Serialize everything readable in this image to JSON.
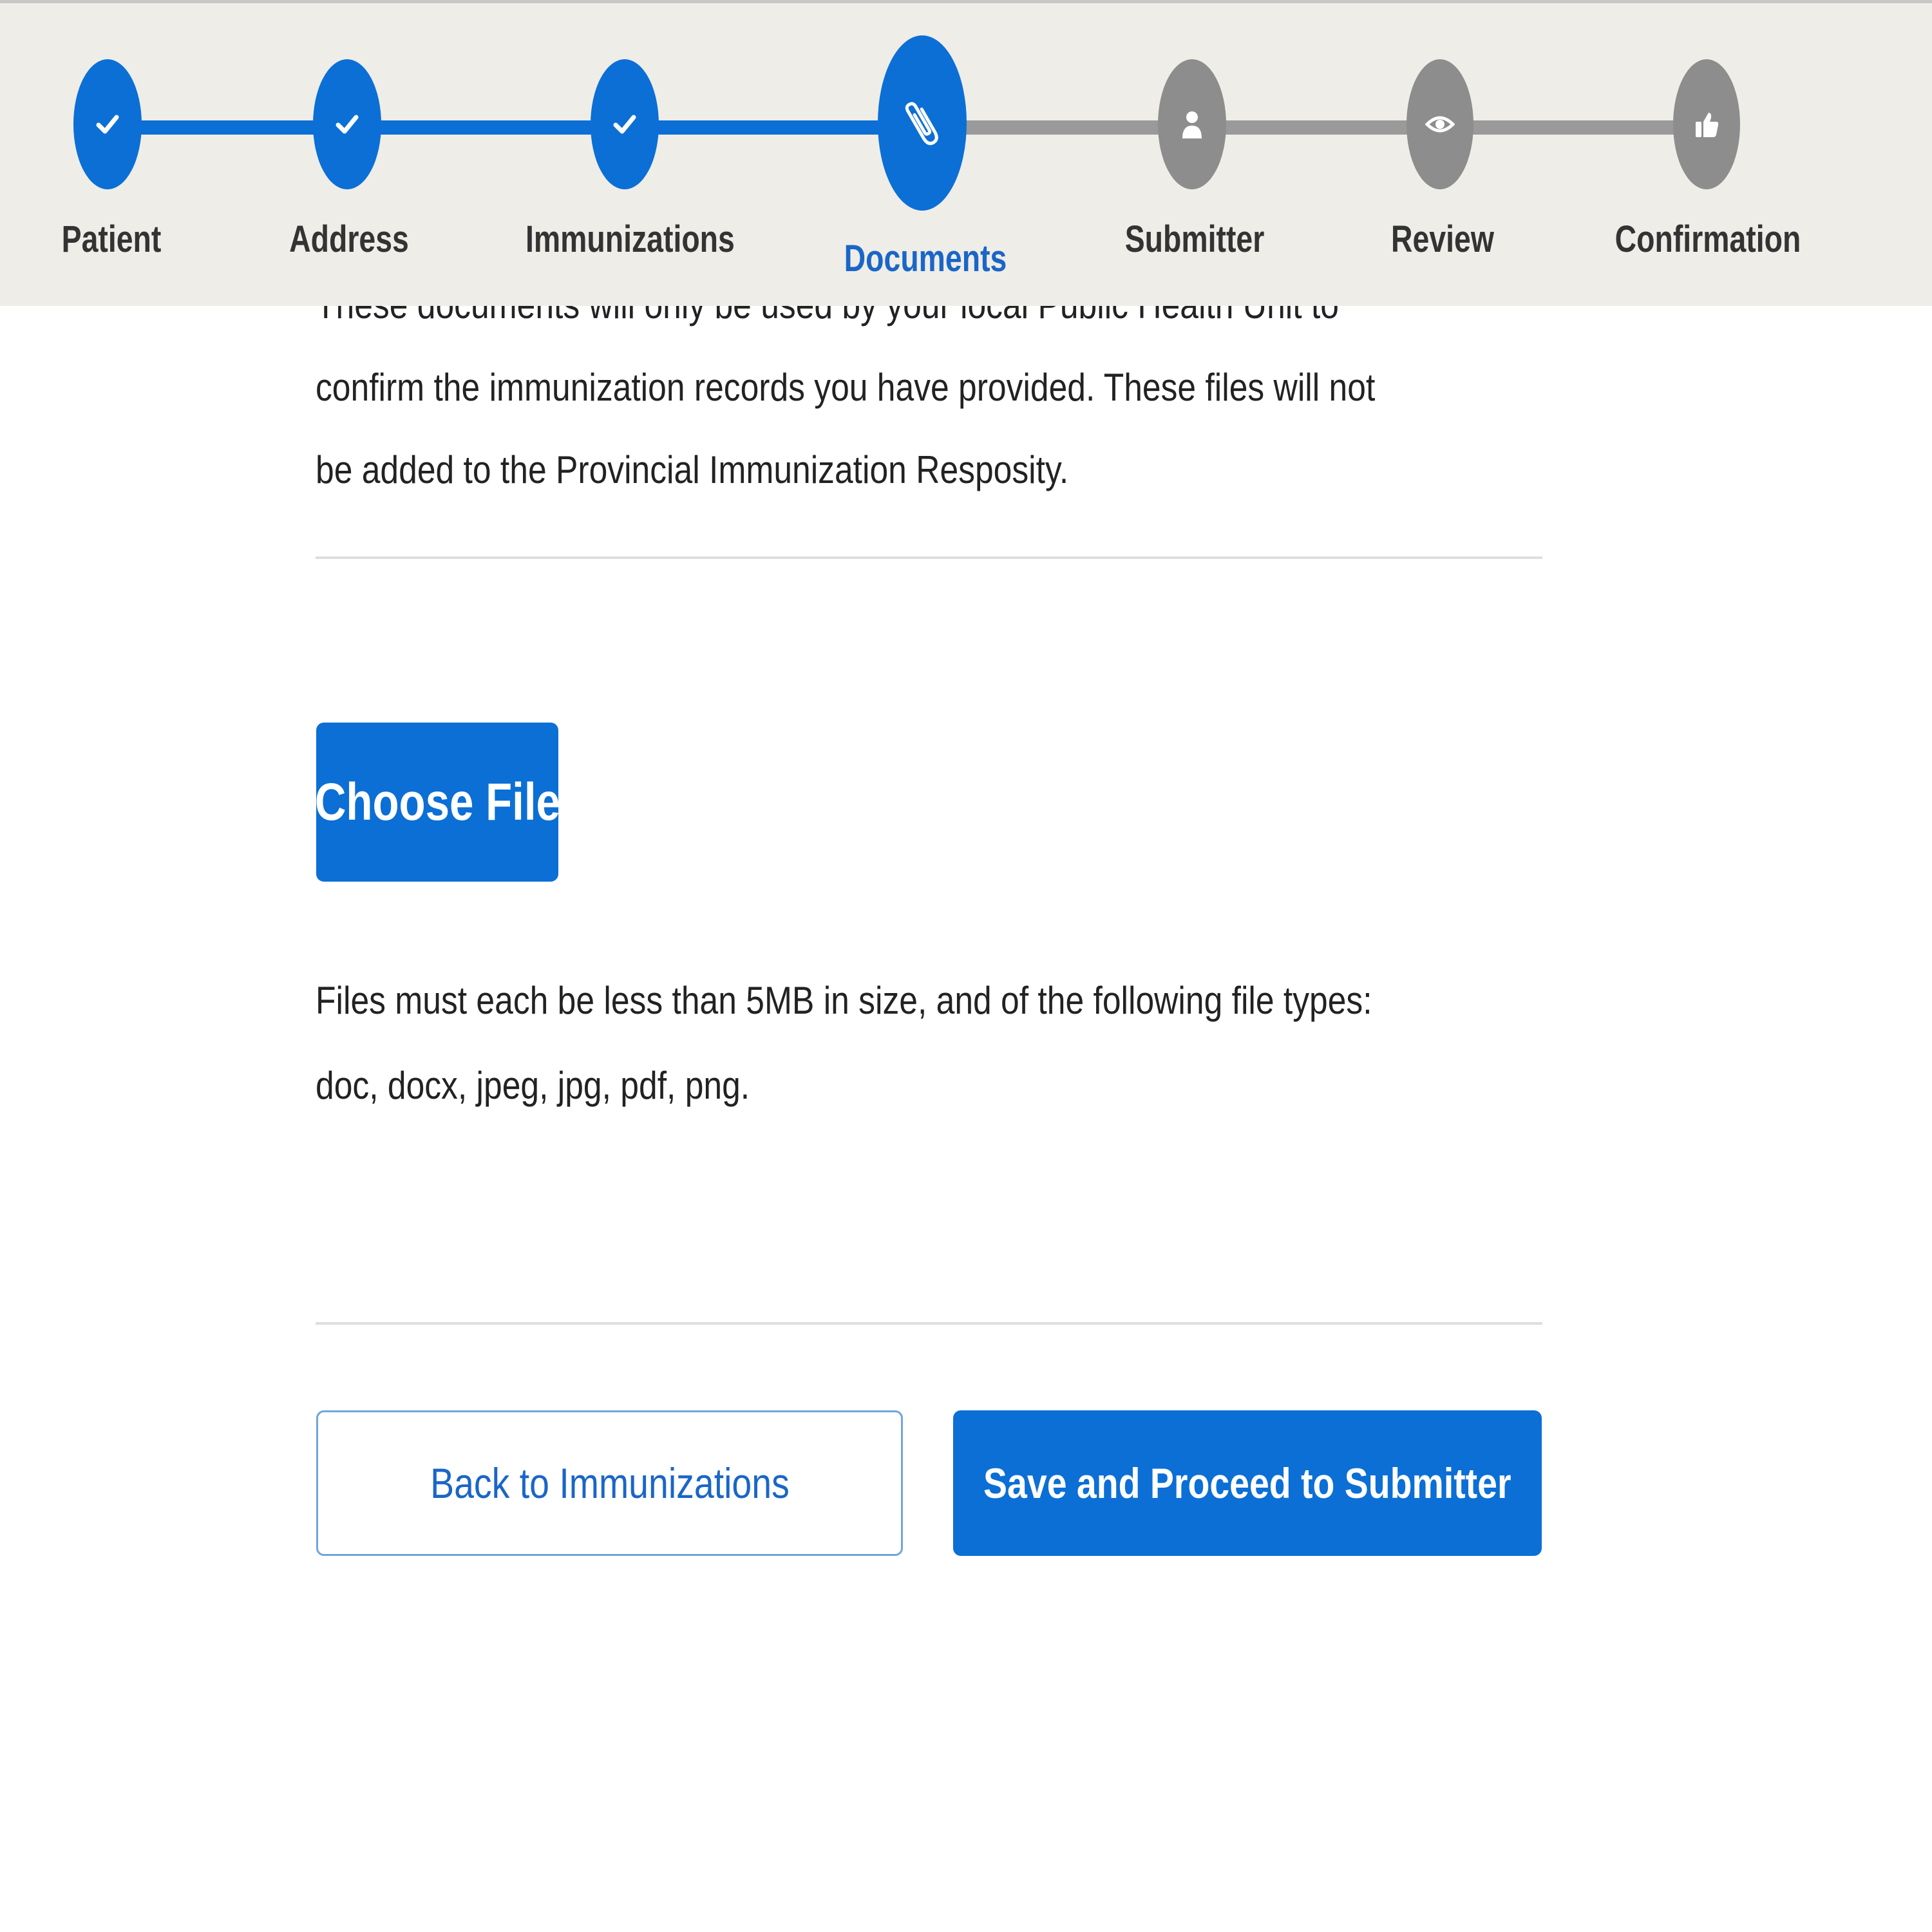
{
  "colors": {
    "primary": "#0b6fd6",
    "stepper_background": "#efede7",
    "step_incomplete": "#8d8d8d",
    "active_label": "#1a66c7",
    "text": "#222222"
  },
  "stepper": {
    "steps": [
      {
        "label": "Patient",
        "state": "done",
        "icon": "check-icon"
      },
      {
        "label": "Address",
        "state": "done",
        "icon": "check-icon"
      },
      {
        "label": "Immunizations",
        "state": "done",
        "icon": "check-icon"
      },
      {
        "label": "Documents",
        "state": "active",
        "icon": "paperclip-icon"
      },
      {
        "label": "Submitter",
        "state": "todo",
        "icon": "person-icon"
      },
      {
        "label": "Review",
        "state": "todo",
        "icon": "eye-icon"
      },
      {
        "label": "Confirmation",
        "state": "todo",
        "icon": "thumbs-up-icon"
      }
    ]
  },
  "documents": {
    "intro_text": "These documents will only be used by your local Public Health Unit to confirm the immunization records you have provided. These files will not be added to the Provincial Immunization Resposity.",
    "choose_file_label": "Choose File",
    "file_requirements": "Files must each be less than 5MB in size, and of the following file types: doc, docx, jpeg, jpg, pdf, png."
  },
  "actions": {
    "back_label": "Back to Immunizations",
    "save_label": "Save and Proceed to Submitter"
  }
}
